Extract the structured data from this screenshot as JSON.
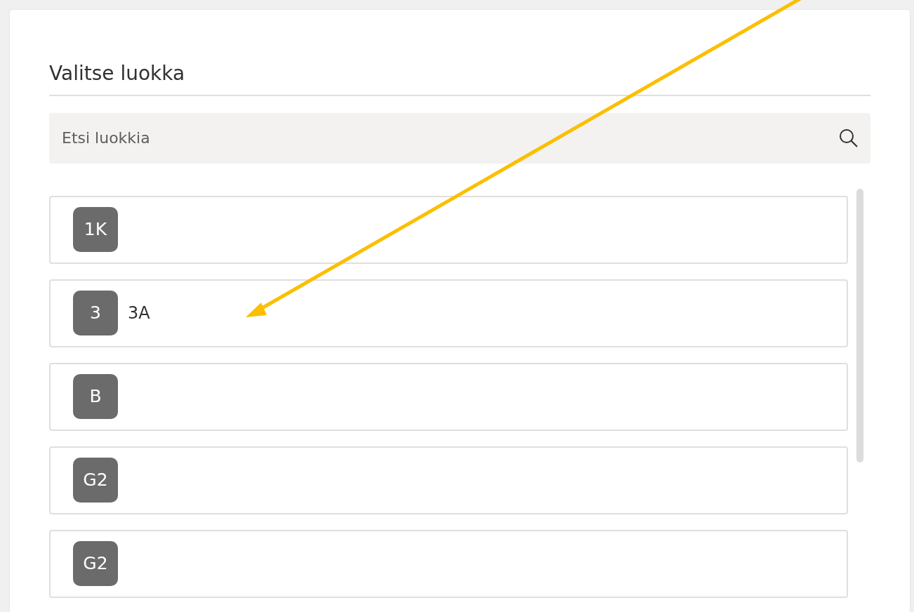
{
  "panel": {
    "title": "Valitse luokka"
  },
  "search": {
    "placeholder": "Etsi luokkia"
  },
  "classes": [
    {
      "badge": "1K"
    },
    {
      "badge": "3",
      "name": "3A"
    },
    {
      "badge": "B"
    },
    {
      "badge": "G2"
    },
    {
      "badge": "G2"
    }
  ]
}
